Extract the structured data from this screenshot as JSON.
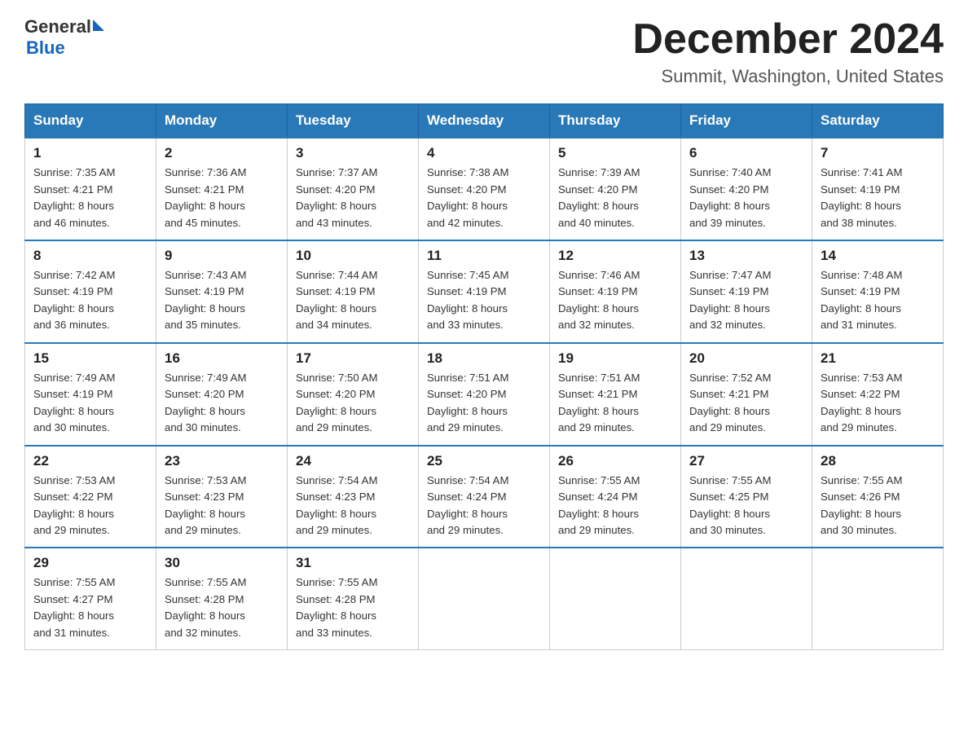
{
  "header": {
    "logo_general": "General",
    "logo_blue": "Blue",
    "title": "December 2024",
    "subtitle": "Summit, Washington, United States"
  },
  "days_of_week": [
    "Sunday",
    "Monday",
    "Tuesday",
    "Wednesday",
    "Thursday",
    "Friday",
    "Saturday"
  ],
  "weeks": [
    [
      {
        "day": "1",
        "sunrise": "7:35 AM",
        "sunset": "4:21 PM",
        "daylight": "8 hours and 46 minutes."
      },
      {
        "day": "2",
        "sunrise": "7:36 AM",
        "sunset": "4:21 PM",
        "daylight": "8 hours and 45 minutes."
      },
      {
        "day": "3",
        "sunrise": "7:37 AM",
        "sunset": "4:20 PM",
        "daylight": "8 hours and 43 minutes."
      },
      {
        "day": "4",
        "sunrise": "7:38 AM",
        "sunset": "4:20 PM",
        "daylight": "8 hours and 42 minutes."
      },
      {
        "day": "5",
        "sunrise": "7:39 AM",
        "sunset": "4:20 PM",
        "daylight": "8 hours and 40 minutes."
      },
      {
        "day": "6",
        "sunrise": "7:40 AM",
        "sunset": "4:20 PM",
        "daylight": "8 hours and 39 minutes."
      },
      {
        "day": "7",
        "sunrise": "7:41 AM",
        "sunset": "4:19 PM",
        "daylight": "8 hours and 38 minutes."
      }
    ],
    [
      {
        "day": "8",
        "sunrise": "7:42 AM",
        "sunset": "4:19 PM",
        "daylight": "8 hours and 36 minutes."
      },
      {
        "day": "9",
        "sunrise": "7:43 AM",
        "sunset": "4:19 PM",
        "daylight": "8 hours and 35 minutes."
      },
      {
        "day": "10",
        "sunrise": "7:44 AM",
        "sunset": "4:19 PM",
        "daylight": "8 hours and 34 minutes."
      },
      {
        "day": "11",
        "sunrise": "7:45 AM",
        "sunset": "4:19 PM",
        "daylight": "8 hours and 33 minutes."
      },
      {
        "day": "12",
        "sunrise": "7:46 AM",
        "sunset": "4:19 PM",
        "daylight": "8 hours and 32 minutes."
      },
      {
        "day": "13",
        "sunrise": "7:47 AM",
        "sunset": "4:19 PM",
        "daylight": "8 hours and 32 minutes."
      },
      {
        "day": "14",
        "sunrise": "7:48 AM",
        "sunset": "4:19 PM",
        "daylight": "8 hours and 31 minutes."
      }
    ],
    [
      {
        "day": "15",
        "sunrise": "7:49 AM",
        "sunset": "4:19 PM",
        "daylight": "8 hours and 30 minutes."
      },
      {
        "day": "16",
        "sunrise": "7:49 AM",
        "sunset": "4:20 PM",
        "daylight": "8 hours and 30 minutes."
      },
      {
        "day": "17",
        "sunrise": "7:50 AM",
        "sunset": "4:20 PM",
        "daylight": "8 hours and 29 minutes."
      },
      {
        "day": "18",
        "sunrise": "7:51 AM",
        "sunset": "4:20 PM",
        "daylight": "8 hours and 29 minutes."
      },
      {
        "day": "19",
        "sunrise": "7:51 AM",
        "sunset": "4:21 PM",
        "daylight": "8 hours and 29 minutes."
      },
      {
        "day": "20",
        "sunrise": "7:52 AM",
        "sunset": "4:21 PM",
        "daylight": "8 hours and 29 minutes."
      },
      {
        "day": "21",
        "sunrise": "7:53 AM",
        "sunset": "4:22 PM",
        "daylight": "8 hours and 29 minutes."
      }
    ],
    [
      {
        "day": "22",
        "sunrise": "7:53 AM",
        "sunset": "4:22 PM",
        "daylight": "8 hours and 29 minutes."
      },
      {
        "day": "23",
        "sunrise": "7:53 AM",
        "sunset": "4:23 PM",
        "daylight": "8 hours and 29 minutes."
      },
      {
        "day": "24",
        "sunrise": "7:54 AM",
        "sunset": "4:23 PM",
        "daylight": "8 hours and 29 minutes."
      },
      {
        "day": "25",
        "sunrise": "7:54 AM",
        "sunset": "4:24 PM",
        "daylight": "8 hours and 29 minutes."
      },
      {
        "day": "26",
        "sunrise": "7:55 AM",
        "sunset": "4:24 PM",
        "daylight": "8 hours and 29 minutes."
      },
      {
        "day": "27",
        "sunrise": "7:55 AM",
        "sunset": "4:25 PM",
        "daylight": "8 hours and 30 minutes."
      },
      {
        "day": "28",
        "sunrise": "7:55 AM",
        "sunset": "4:26 PM",
        "daylight": "8 hours and 30 minutes."
      }
    ],
    [
      {
        "day": "29",
        "sunrise": "7:55 AM",
        "sunset": "4:27 PM",
        "daylight": "8 hours and 31 minutes."
      },
      {
        "day": "30",
        "sunrise": "7:55 AM",
        "sunset": "4:28 PM",
        "daylight": "8 hours and 32 minutes."
      },
      {
        "day": "31",
        "sunrise": "7:55 AM",
        "sunset": "4:28 PM",
        "daylight": "8 hours and 33 minutes."
      },
      null,
      null,
      null,
      null
    ]
  ],
  "labels": {
    "sunrise": "Sunrise:",
    "sunset": "Sunset:",
    "daylight": "Daylight:"
  }
}
